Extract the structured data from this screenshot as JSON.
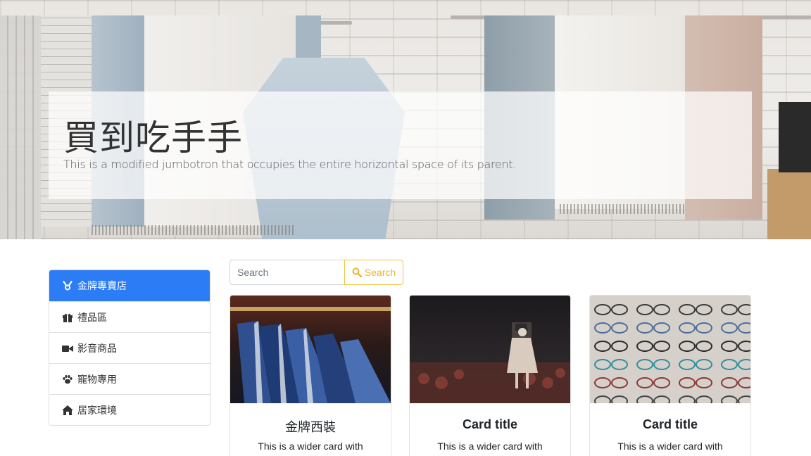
{
  "hero": {
    "title": "買到吃手手",
    "lead": "This is a modified jumbotron that occupies the entire horizontal space of its parent."
  },
  "sidebar": {
    "items": [
      {
        "label": "金牌專賣店",
        "icon": "medal-icon",
        "active": true
      },
      {
        "label": "禮品區",
        "icon": "gift-icon",
        "active": false
      },
      {
        "label": "影音商品",
        "icon": "video-camera-icon",
        "active": false
      },
      {
        "label": "寵物專用",
        "icon": "paw-icon",
        "active": false
      },
      {
        "label": "居家環境",
        "icon": "home-icon",
        "active": false
      }
    ]
  },
  "search": {
    "placeholder": "Search",
    "button_label": "Search",
    "button_color": "#f0b428"
  },
  "cards": [
    {
      "title": "金牌西裝",
      "text": "This is a wider card with",
      "image": "suits-on-rack-photo"
    },
    {
      "title": "Card title",
      "text": "This is a wider card with",
      "image": "shop-window-mannequin-photo"
    },
    {
      "title": "Card title",
      "text": "This is a wider card with",
      "image": "eyeglasses-display-photo"
    }
  ],
  "colors": {
    "active_item": "#2c7cf6",
    "search_accent": "#f5c242"
  }
}
